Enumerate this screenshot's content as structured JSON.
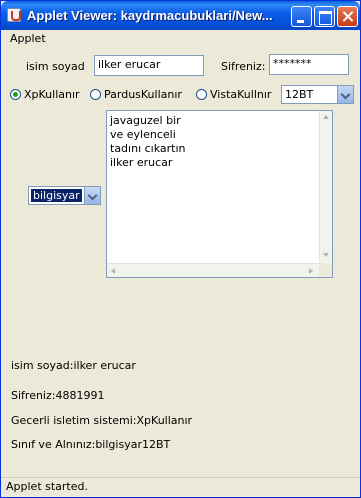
{
  "window": {
    "title": "Applet Viewer: kaydrmacubuklari/New...",
    "buttons": [
      "minimize",
      "maximize",
      "close"
    ]
  },
  "menu": {
    "applet_label": "Applet"
  },
  "form": {
    "name_label": "isim soyad",
    "name_value": "ilker erucar",
    "password_label": "Sifreniz:",
    "password_value": "*******"
  },
  "os_options": [
    {
      "label": "XpKullanır",
      "selected": true
    },
    {
      "label": "PardusKullanır",
      "selected": false
    },
    {
      "label": "VistaKullnır",
      "selected": false
    }
  ],
  "class_combo": {
    "value": "12BT"
  },
  "dept_combo": {
    "value": "bilgisyar"
  },
  "textarea": {
    "lines": [
      "javaguzel bir",
      "ve eylenceli",
      "tadını cıkartın",
      "ilker erucar"
    ]
  },
  "output": {
    "name_line": "isim soyad:ilker erucar",
    "password_line": "Sifreniz:4881991",
    "os_line": "Gecerli isletim sistemi:XpKullanır",
    "class_line": "Sınıf ve Alnınız:bilgisyar12BT"
  },
  "status": {
    "text": "Applet started."
  },
  "colors": {
    "titlebar": "#0550d8",
    "background": "#ece9d8",
    "radio_selected": "#21a121"
  }
}
